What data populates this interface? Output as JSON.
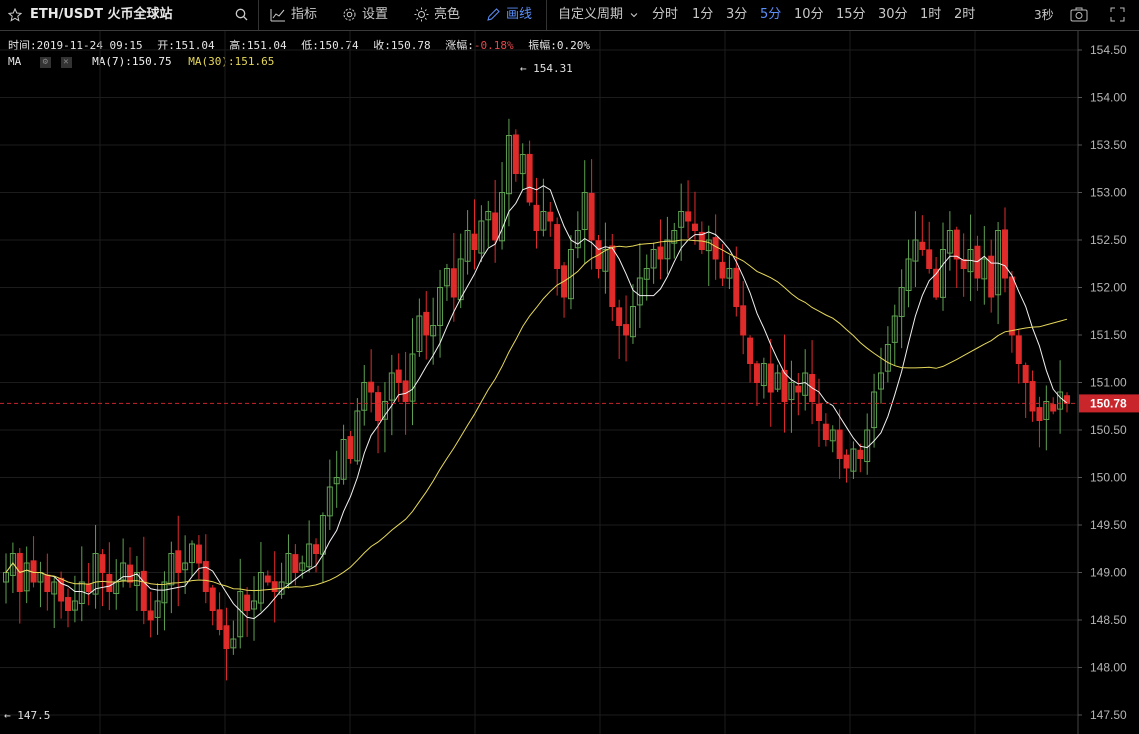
{
  "toolbar": {
    "symbol": "ETH/USDT 火币全球站",
    "indicators": "指标",
    "settings": "设置",
    "brightness": "亮色",
    "draw": "画线",
    "custom_period": "自定义周期",
    "periods": [
      "分时",
      "1分",
      "3分",
      "5分",
      "10分",
      "15分",
      "30分",
      "1时",
      "2时"
    ],
    "active_period": "5分",
    "refresh": "3秒"
  },
  "info": {
    "time_label": "时间:",
    "time": "2019-11-24 09:15",
    "open_label": "开:",
    "open": "151.04",
    "high_label": "高:",
    "high": "151.04",
    "low_label": "低:",
    "low": "150.74",
    "close_label": "收:",
    "close": "150.78",
    "change_label": "涨幅:",
    "change": "-0.18%",
    "amplitude_label": "振幅:",
    "amplitude": "0.20%"
  },
  "ma": {
    "label": "MA",
    "ma7_label": "MA(7):",
    "ma7": "150.75",
    "ma30_label": "MA(30):",
    "ma30": "151.65"
  },
  "colors": {
    "up": "#5ea052",
    "down": "#e02b2b",
    "ma7": "#f0f0f0",
    "ma30": "#e6d85a",
    "price_tag": "#c8262b",
    "active": "#5b8ff9"
  },
  "chart_data": {
    "type": "candlestick",
    "ylim": [
      147.3,
      154.7
    ],
    "y_ticks": [
      147.5,
      148.0,
      148.5,
      149.0,
      149.5,
      150.0,
      150.5,
      150.78,
      151.0,
      151.5,
      152.0,
      152.5,
      153.0,
      153.5,
      154.0,
      154.5
    ],
    "y_tick_labels": [
      "147.50",
      "148.00",
      "148.50",
      "149.00",
      "149.50",
      "150.00",
      "150.50",
      "150.78",
      "151.00",
      "151.50",
      "152.00",
      "152.50",
      "153.00",
      "153.50",
      "154.00",
      "154.50"
    ],
    "last_price": 150.78,
    "last_price_label": "150.78",
    "annotations": [
      {
        "text": "← 154.31",
        "value": 154.31,
        "candle": 74
      },
      {
        "text": "← 147.5",
        "value": 147.5,
        "candle": 0
      }
    ],
    "closes": [
      149.0,
      149.2,
      148.8,
      149.1,
      148.9,
      149.0,
      148.8,
      148.9,
      148.7,
      148.6,
      148.7,
      148.9,
      148.8,
      149.2,
      149.0,
      148.8,
      148.9,
      149.1,
      148.9,
      149.0,
      148.6,
      148.5,
      148.7,
      148.9,
      149.2,
      149.0,
      149.1,
      149.3,
      149.1,
      148.8,
      148.6,
      148.4,
      148.2,
      148.3,
      148.8,
      148.6,
      148.7,
      149.0,
      148.9,
      148.8,
      148.9,
      149.2,
      149.0,
      149.1,
      149.3,
      149.2,
      149.6,
      149.9,
      150.0,
      150.4,
      150.2,
      150.7,
      151.0,
      150.9,
      150.6,
      150.8,
      151.1,
      151.0,
      150.8,
      151.3,
      151.7,
      151.5,
      151.6,
      152.0,
      152.2,
      151.9,
      152.3,
      152.6,
      152.4,
      152.7,
      152.8,
      152.5,
      153.0,
      153.6,
      153.2,
      153.4,
      152.9,
      152.6,
      152.8,
      152.7,
      152.2,
      151.9,
      152.4,
      152.6,
      153.0,
      152.5,
      152.2,
      152.4,
      151.8,
      151.6,
      151.5,
      151.8,
      152.1,
      152.2,
      152.4,
      152.3,
      152.5,
      152.6,
      152.8,
      152.7,
      152.6,
      152.4,
      152.5,
      152.3,
      152.1,
      152.2,
      151.8,
      151.5,
      151.2,
      151.0,
      151.2,
      150.9,
      151.1,
      150.8,
      151.0,
      150.9,
      151.1,
      150.8,
      150.6,
      150.4,
      150.5,
      150.2,
      150.1,
      150.3,
      150.2,
      150.5,
      150.9,
      151.1,
      151.4,
      151.7,
      152.0,
      152.3,
      152.5,
      152.4,
      152.2,
      151.9,
      152.4,
      152.6,
      152.3,
      152.2,
      152.4,
      152.1,
      152.3,
      151.9,
      152.6,
      152.1,
      151.5,
      151.2,
      151.0,
      150.7,
      150.6,
      150.8,
      150.7,
      150.9,
      150.78
    ],
    "ma7_last": 150.75,
    "ma30_last": 151.65
  }
}
